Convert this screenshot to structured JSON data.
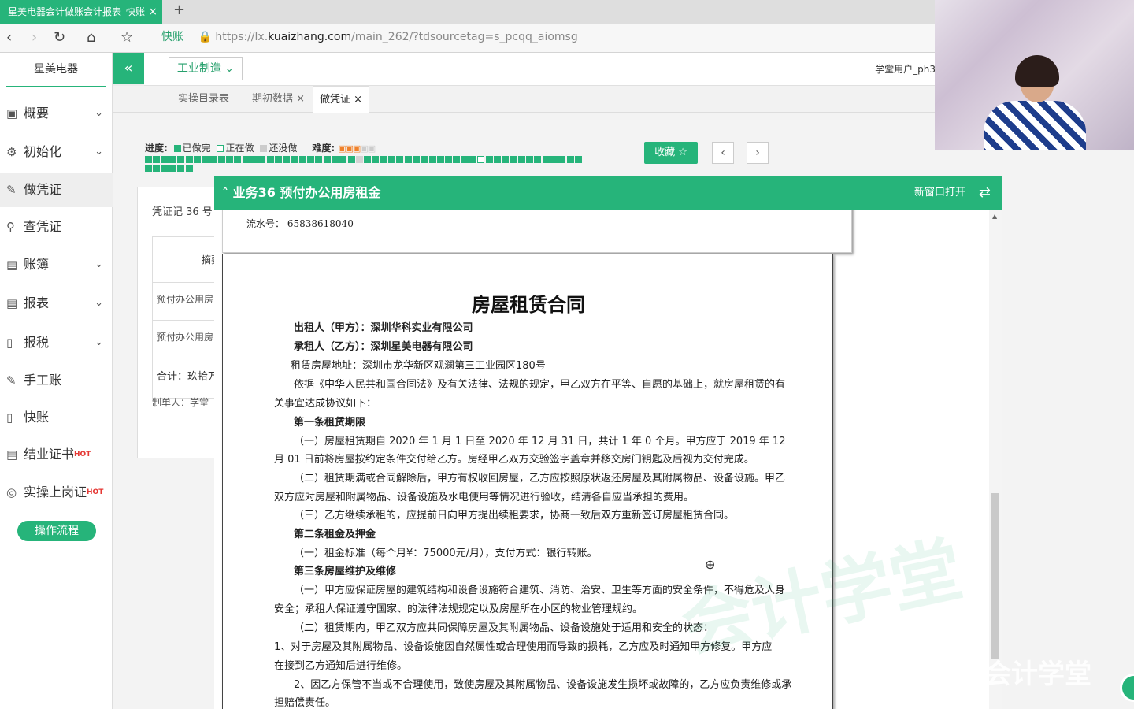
{
  "browser": {
    "tab_title": "星美电器会计做账会计报表_快账",
    "tab_close": "×",
    "new_tab": "+",
    "brand": "快账",
    "url_prefix": "https://lx.",
    "url_host": "kuaizhang.com",
    "url_path": "/main_262/?tdsourcetag=s_pcqq_aiomsg"
  },
  "sidebar": {
    "company": "星美电器",
    "items": [
      {
        "label": "概要"
      },
      {
        "label": "初始化"
      },
      {
        "label": "做凭证"
      },
      {
        "label": "查凭证"
      },
      {
        "label": "账簿"
      },
      {
        "label": "报表"
      },
      {
        "label": "报税"
      },
      {
        "label": "手工账"
      },
      {
        "label": "快账"
      },
      {
        "label": "结业证书"
      },
      {
        "label": "实操上岗证"
      }
    ],
    "hot": "HOT",
    "flow_button": "操作流程"
  },
  "topbar": {
    "collapse": "«",
    "industry": "工业制造",
    "user": "学堂用户_ph3"
  },
  "page_tabs": [
    {
      "label": "实操目录表"
    },
    {
      "label": "期初数据"
    },
    {
      "label": "做凭证"
    }
  ],
  "progress": {
    "label": "进度:",
    "done": "已做完",
    "doing": "正在做",
    "todo": "还没做",
    "difficulty_label": "难度:",
    "difficulty_stars": 3,
    "difficulty_max": 5,
    "total": 60,
    "current": 42,
    "done_count": 60,
    "colors": {
      "done": "#26b47a",
      "todo": "#d3d3d3"
    }
  },
  "actions": {
    "favorite": "收藏 ☆",
    "prev": "‹",
    "next": "›"
  },
  "voucher": {
    "number": "凭证记 36 号",
    "col_summary": "摘要",
    "rows": [
      "预付办公用房",
      "预付办公用房"
    ],
    "total": "合计：玖拾万",
    "maker": "制单人：学堂"
  },
  "panel": {
    "title": "业务36 预付办公用房租金",
    "new_window": "新窗口打开",
    "receipt_serial_label": "流水号：",
    "receipt_serial": "65838618040"
  },
  "contract": {
    "title": "房屋租赁合同",
    "lessor": "出租人（甲方）：深圳华科实业有限公司",
    "lessee": "承租人（乙方）：深圳星美电器有限公司",
    "address": "租赁房屋地址：深圳市龙华新区观澜第三工业园区180号",
    "intro1": "依据《中华人民共和国合同法》及有关法律、法规的规定，甲乙双方在平等、自愿的基础上，就房屋租赁的有",
    "intro2": "关事宜达成协议如下：",
    "art1": "第一条租赁期限",
    "a1p1": "（一）房屋租赁期自 2020 年 1 月 1 日至 2020 年 12 月 31 日，共计 1 年 0 个月。甲方应于 2019 年 12",
    "a1p1b": "月 01 日前将房屋按约定条件交付给乙方。房经甲乙双方交验签字盖章并移交房门钥匙及后视为交付完成。",
    "a1p2": "（二）租赁期满或合同解除后，甲方有权收回房屋，乙方应按照原状返还房屋及其附属物品、设备设施。甲乙",
    "a1p2b": "双方应对房屋和附属物品、设备设施及水电使用等情况进行验收，结清各自应当承担的费用。",
    "a1p3": "（三）乙方继续承租的，应提前日向甲方提出续租要求，协商一致后双方重新签订房屋租赁合同。",
    "art2": "第二条租金及押金",
    "a2p1": "（一）租金标准（每个月¥：75000元/月），支付方式：银行转账。",
    "art3": "第三条房屋维护及维修",
    "a3p1": "（一）甲方应保证房屋的建筑结构和设备设施符合建筑、消防、治安、卫生等方面的安全条件，不得危及人身",
    "a3p1b": "安全；承租人保证遵守国家、的法律法规规定以及房屋所在小区的物业管理规约。",
    "a3p2": "（二）租赁期内，甲乙双方应共同保障房屋及其附属物品、设备设施处于适用和安全的状态：",
    "a3p3": "1、对于房屋及其附属物品、设备设施因自然属性或合理使用而导致的损耗，乙方应及时通知甲方修复。甲方应",
    "a3p3b": "在接到乙方通知后进行维修。",
    "a3p4": "2、因乙方保管不当或不合理使用，致使房屋及其附属物品、设备设施发生损坏或故障的，乙方应负责维修或承",
    "a3p4b": "担赔偿责任。"
  },
  "overlay": {
    "watermark": "会计学堂",
    "brand_watermark": "会计学堂"
  }
}
